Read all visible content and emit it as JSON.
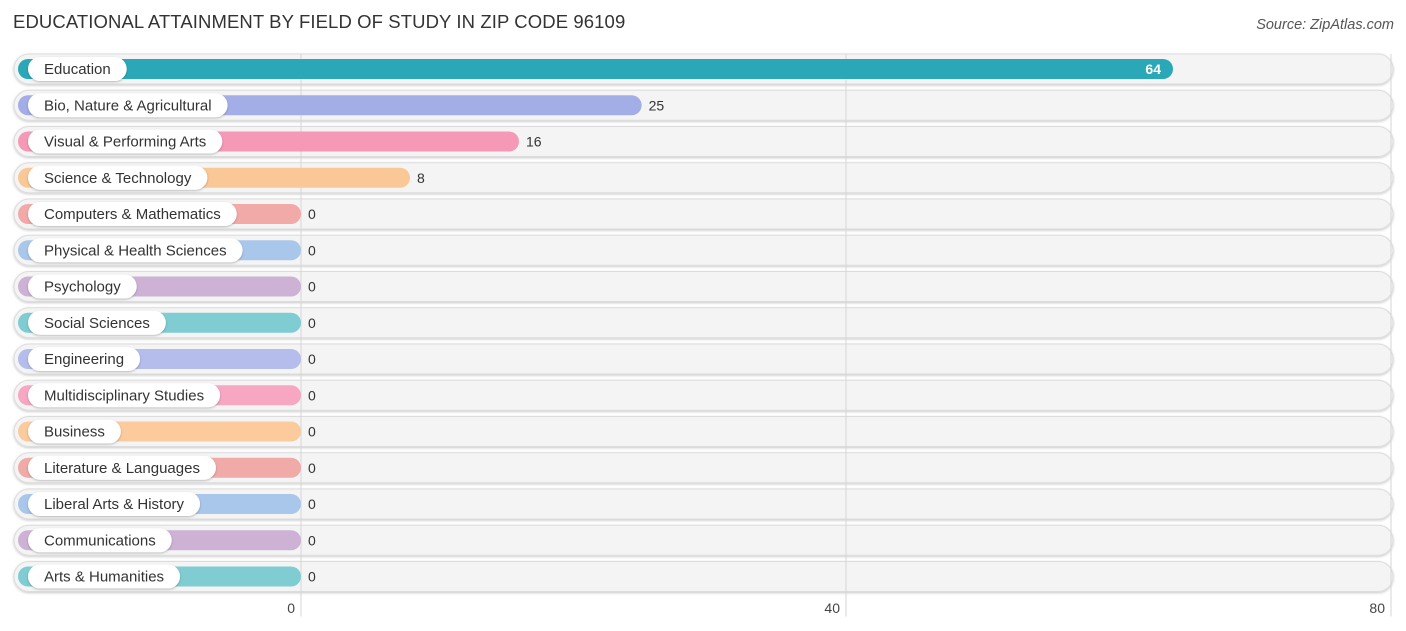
{
  "header": {
    "title": "EDUCATIONAL ATTAINMENT BY FIELD OF STUDY IN ZIP CODE 96109",
    "source": "Source: ZipAtlas.com"
  },
  "chart_data": {
    "type": "bar",
    "orientation": "horizontal",
    "title": "EDUCATIONAL ATTAINMENT BY FIELD OF STUDY IN ZIP CODE 96109",
    "xlabel": "",
    "ylabel": "",
    "xlim": [
      0,
      80
    ],
    "xticks": [
      0,
      40,
      80
    ],
    "grid": true,
    "categories": [
      "Education",
      "Bio, Nature & Agricultural",
      "Visual & Performing Arts",
      "Science & Technology",
      "Computers & Mathematics",
      "Physical & Health Sciences",
      "Psychology",
      "Social Sciences",
      "Engineering",
      "Multidisciplinary Studies",
      "Business",
      "Literature & Languages",
      "Liberal Arts & History",
      "Communications",
      "Arts & Humanities"
    ],
    "values": [
      64,
      25,
      16,
      8,
      0,
      0,
      0,
      0,
      0,
      0,
      0,
      0,
      0,
      0,
      0
    ],
    "colors": [
      "#2aa8b8",
      "#a4aee6",
      "#f599b6",
      "#fac796",
      "#f2aaa9",
      "#a9c6eb",
      "#cdb2d6",
      "#7fccd2",
      "#b5bdec",
      "#f7a7c1",
      "#fbcb9d",
      "#f0aaa8",
      "#a9c6eb",
      "#cdb2d6",
      "#7fccd2"
    ],
    "value_label_inside_threshold": 50
  }
}
